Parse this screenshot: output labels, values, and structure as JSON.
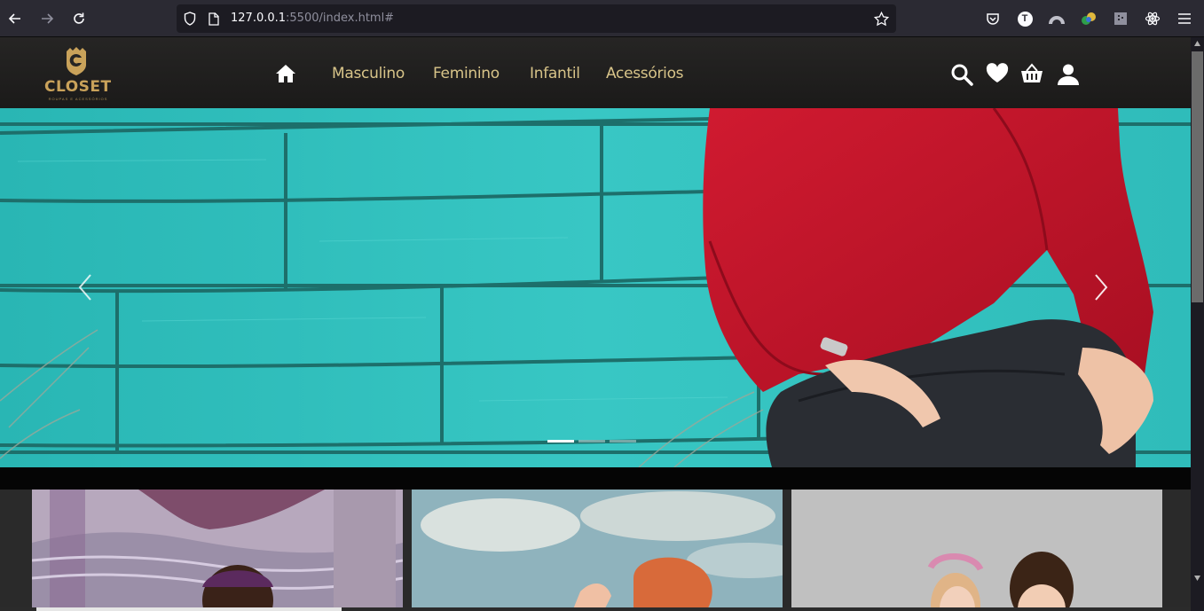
{
  "browser": {
    "url_host": "127.0.0.1",
    "url_rest": ":5500/index.html#",
    "profile_initial": "T"
  },
  "site": {
    "logo_text": "CLOSET",
    "logo_tagline": "ROUPAS E ACESSÓRIOS",
    "nav": [
      {
        "label": "Masculino"
      },
      {
        "label": "Feminino"
      },
      {
        "label": "Infantil"
      },
      {
        "label": "Acessórios"
      }
    ],
    "colors": {
      "gold": "#c9a25a",
      "menu_text": "#d8c489",
      "header_bg": "#232221",
      "hero_wall": "#2fc0bd",
      "sweater": "#c4142c"
    }
  },
  "carousel": {
    "slide_count": 3,
    "active_slide": 1
  }
}
